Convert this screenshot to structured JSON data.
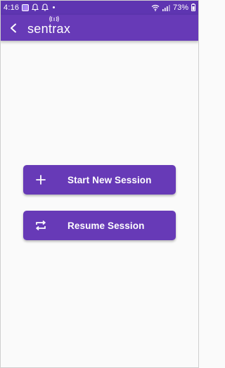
{
  "status_bar": {
    "time": "4:16",
    "battery": "73%"
  },
  "app_bar": {
    "logo_text": "sentrax"
  },
  "menu": {
    "start_label": "Start New Session",
    "resume_label": "Resume Session"
  },
  "colors": {
    "primary": "#673ab7",
    "status_bar": "#5e35b1",
    "background": "#fafafa",
    "text_on_primary": "#ffffff"
  },
  "icons": {
    "back": "arrow-back-icon",
    "start": "plus-icon",
    "resume": "repeat-icon"
  }
}
